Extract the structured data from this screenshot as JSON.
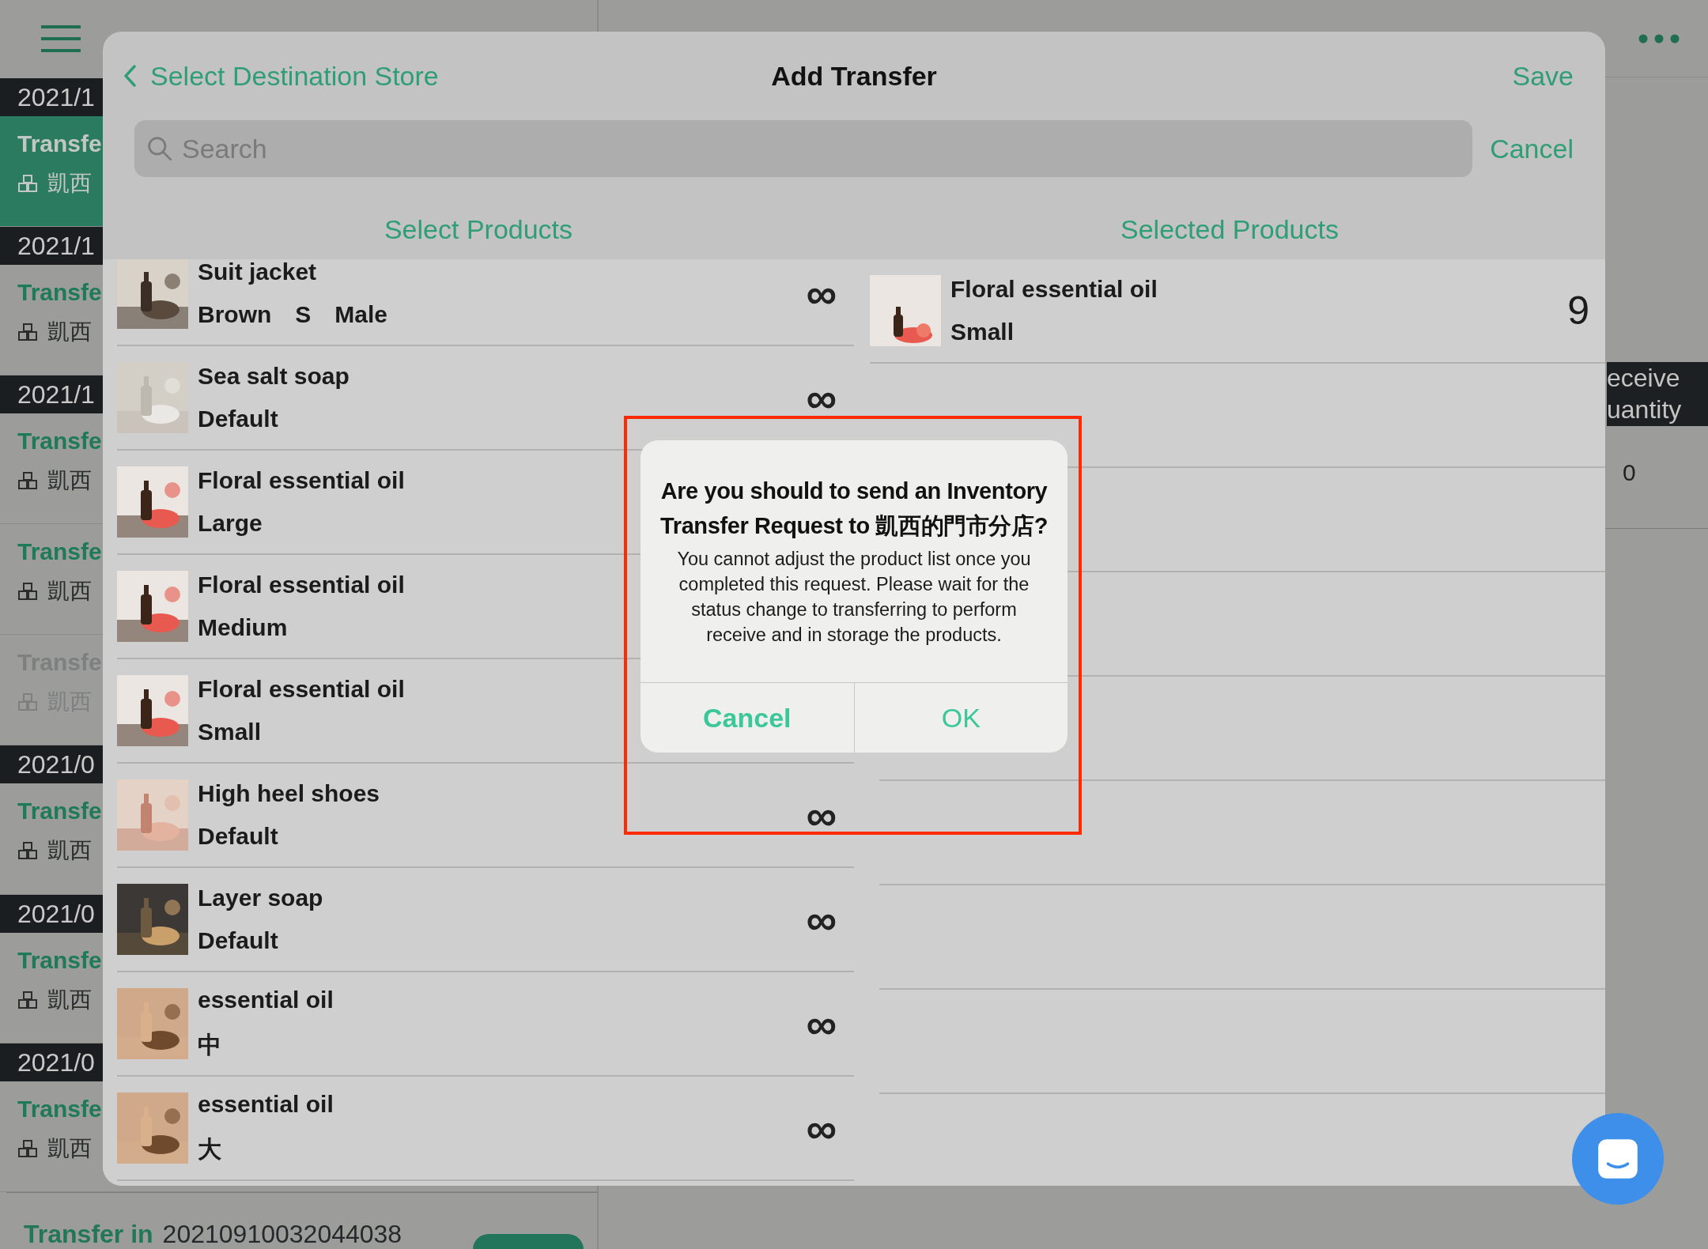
{
  "background": {
    "list": [
      {
        "kind": "date",
        "text": "2021/1"
      },
      {
        "kind": "transfer",
        "title": "Transfe",
        "store": "凱西",
        "selected": true,
        "disabled": false
      },
      {
        "kind": "date",
        "text": "2021/1"
      },
      {
        "kind": "transfer",
        "title": "Transfe",
        "store": "凱西",
        "selected": false,
        "disabled": false
      },
      {
        "kind": "date",
        "text": "2021/1"
      },
      {
        "kind": "transfer",
        "title": "Transfe",
        "store": "凱西",
        "selected": false,
        "disabled": false
      },
      {
        "kind": "transfer",
        "title": "Transfe",
        "store": "凱西",
        "selected": false,
        "disabled": false
      },
      {
        "kind": "transfer",
        "title": "Transfe",
        "store": "凱西",
        "selected": false,
        "disabled": true
      },
      {
        "kind": "date",
        "text": "2021/0"
      },
      {
        "kind": "transfer",
        "title": "Transfe",
        "store": "凱西",
        "selected": false,
        "disabled": false
      },
      {
        "kind": "date",
        "text": "2021/0"
      },
      {
        "kind": "transfer",
        "title": "Transfe",
        "store": "凱西",
        "selected": false,
        "disabled": false
      },
      {
        "kind": "date",
        "text": "2021/0"
      },
      {
        "kind": "transfer",
        "title": "Transfe",
        "store": "凱西",
        "selected": false,
        "disabled": false
      }
    ],
    "footer_item": {
      "type_label": "Transfer in",
      "number": "20210910032044038"
    },
    "column_header": [
      "eceive",
      "uantity"
    ],
    "column_value": "0"
  },
  "sheet": {
    "back_label": "Select Destination Store",
    "title": "Add Transfer",
    "save": "Save",
    "search": {
      "placeholder": "Search"
    },
    "cancel": "Cancel",
    "segments": [
      {
        "label": "Select Products",
        "selected": false
      },
      {
        "label": "Selected Products",
        "selected": false
      }
    ],
    "products": [
      {
        "name": "Suit jacket",
        "variants": [
          "Brown",
          "S",
          "Male"
        ],
        "quantity": "∞"
      },
      {
        "name": "Sea salt soap",
        "variants": [
          "Default"
        ],
        "quantity": "∞"
      },
      {
        "name": "Floral essential oil",
        "variants": [
          "Large"
        ]
      },
      {
        "name": "Floral essential oil",
        "variants": [
          "Medium"
        ]
      },
      {
        "name": "Floral essential oil",
        "variants": [
          "Small"
        ]
      },
      {
        "name": "High heel shoes",
        "variants": [
          "Default"
        ],
        "quantity": "∞"
      },
      {
        "name": "Layer soap",
        "variants": [
          "Default"
        ],
        "quantity": "∞"
      },
      {
        "name": "essential oil",
        "variants": [
          "中"
        ],
        "quantity": "∞"
      },
      {
        "name": "essential oil",
        "variants": [
          "大"
        ],
        "quantity": "∞"
      }
    ],
    "selected_products": [
      {
        "name": "Floral essential oil",
        "variants": [
          "Small"
        ],
        "quantity": "9"
      }
    ]
  },
  "alert": {
    "title": "Are you should to send an Inventory Transfer Request to 凱西的門市分店?",
    "message": "You cannot adjust the product list once you completed this request. Please wait for the status change to transferring to perform receive and in storage the products.",
    "buttons": [
      {
        "label": "Cancel",
        "kind": "preferred"
      },
      {
        "label": "OK",
        "kind": "normal"
      }
    ]
  }
}
